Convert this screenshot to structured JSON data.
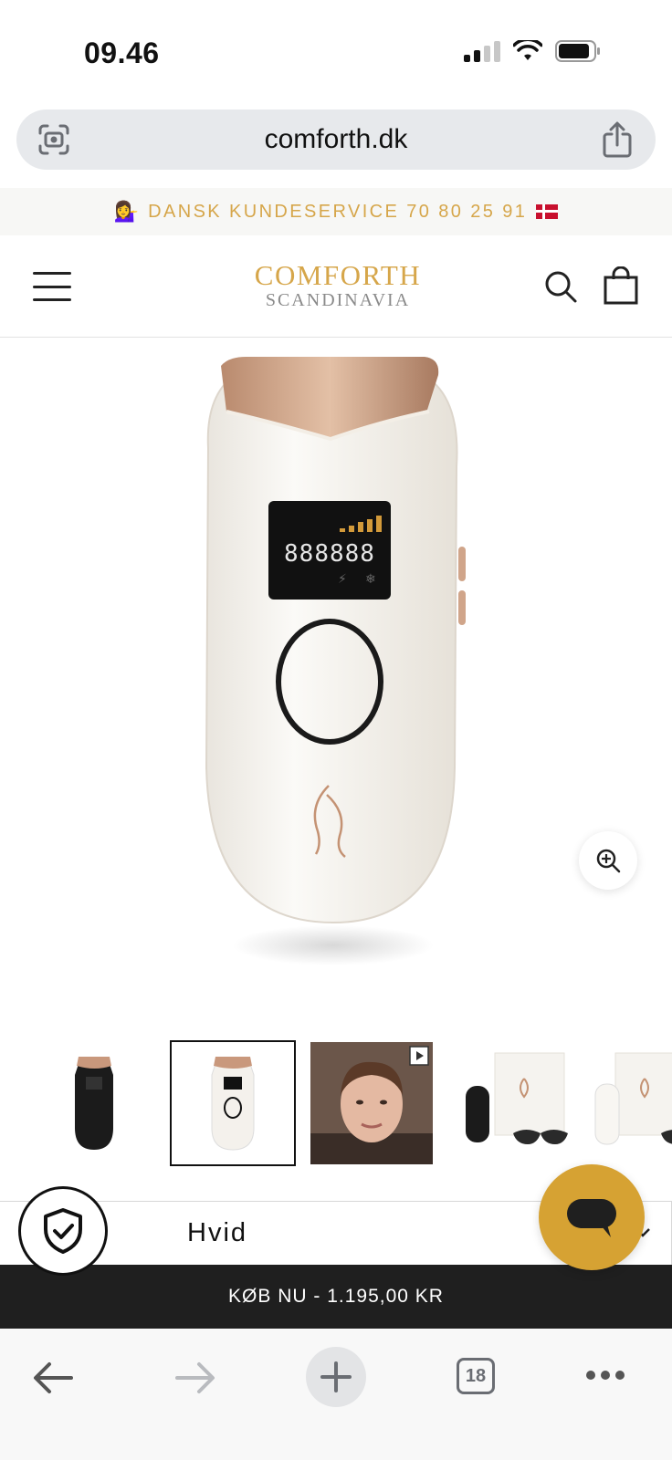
{
  "status": {
    "time": "09.46"
  },
  "browser": {
    "url": "comforth.dk",
    "tab_count": "18"
  },
  "announcement": {
    "text": "DANSK KUNDESERVICE 70 80 25 91",
    "emoji": "💁‍♀️"
  },
  "header": {
    "logo_main": "COMFORTH",
    "logo_sub": "SCANDINAVIA"
  },
  "product": {
    "gallery": {
      "thumbnails": [
        {
          "name": "black-device",
          "selected": false
        },
        {
          "name": "white-device",
          "selected": true
        },
        {
          "name": "video-review",
          "selected": false,
          "is_video": true
        },
        {
          "name": "device-with-box-and-glasses",
          "selected": false
        },
        {
          "name": "white-device-with-box",
          "selected": false
        }
      ]
    },
    "variant": {
      "selected": "Hvid"
    },
    "buy": {
      "label": "KØB NU  -  1.195,00 KR"
    }
  },
  "colors": {
    "accent_gold": "#d6a64a",
    "chat_gold": "#d6a233",
    "buy_bar": "#1f1f1f"
  }
}
